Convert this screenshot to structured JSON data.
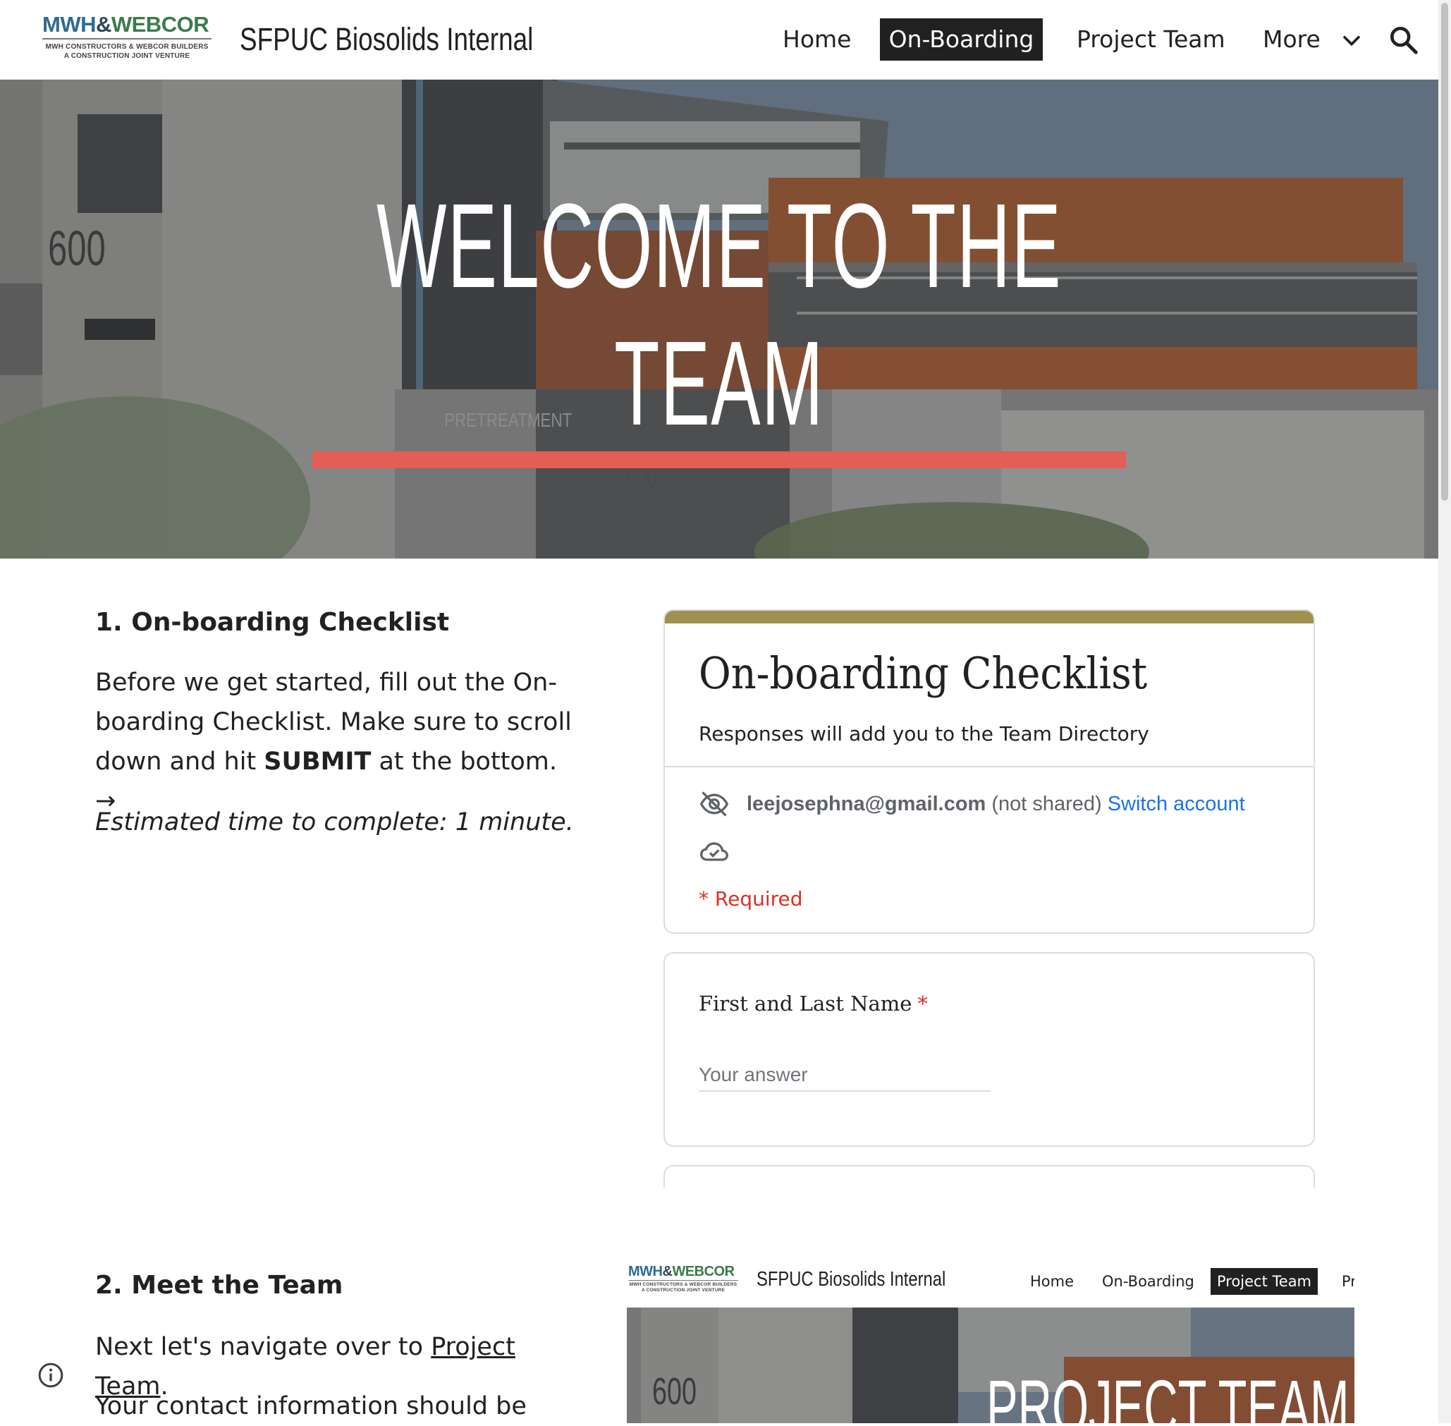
{
  "header": {
    "logo": {
      "main_a": "MWH",
      "main_amp": "&",
      "main_b": "WEBCOR",
      "sub_line1": "MWH CONSTRUCTORS & WEBCOR BUILDERS",
      "sub_line2": "A CONSTRUCTION JOINT VENTURE"
    },
    "site_title": "SFPUC Biosolids Internal",
    "nav": [
      {
        "label": "Home",
        "active": false
      },
      {
        "label": "On-Boarding",
        "active": true
      },
      {
        "label": "Project Team",
        "active": false
      },
      {
        "label": "More",
        "active": false
      }
    ],
    "icons": {
      "more": "chevron-down-icon",
      "search": "search-icon"
    }
  },
  "hero": {
    "title_line1": "WELCOME TO THE",
    "title_line2": "TEAM",
    "building_number": "600",
    "building_number_small": "600",
    "sign_text": "PRETREATMENT",
    "accent_color": "#e25e57"
  },
  "section1": {
    "heading": "1. On-boarding Checklist",
    "para1_before": "Before we get started, fill out the On-boarding Checklist. Make sure to scroll down and hit ",
    "para1_bold": "SUBMIT",
    "para1_after": " at the bottom. →",
    "para2": "Estimated time to complete: 1 minute."
  },
  "form": {
    "accent_color": "#a1914f",
    "title": "On-boarding Checklist",
    "description": "Responses will add you to the Team Directory",
    "account_email": "leejosephna@gmail.com",
    "account_not_shared": "(not shared)",
    "switch_account": "Switch account",
    "required_note": "* Required",
    "question1_label": "First and Last Name",
    "question1_star": "*",
    "question1_placeholder": "Your answer",
    "icons": {
      "hidden": "eye-off-icon",
      "saved": "cloud-check-icon"
    }
  },
  "section2": {
    "heading": "2. Meet the Team",
    "para1_before": "Next let's navigate over to ",
    "para1_link": "Project Team",
    "para1_after": ".",
    "para2": "Your contact information should be"
  },
  "preview": {
    "logo_main_a": "MWH",
    "logo_amp": "&",
    "logo_main_b": "WEBCOR",
    "logo_sub1": "MWH CONSTRUCTORS & WEBCOR BUILDERS",
    "logo_sub2": "A CONSTRUCTION JOINT VENTURE",
    "site_title": "SFPUC Biosolids Internal",
    "nav_home": "Home",
    "nav_onboarding": "On-Boarding",
    "nav_project_team": "Project Team",
    "nav_partial": "Pr",
    "building_number": "600",
    "hero_title": "PROJECT TEAM"
  }
}
